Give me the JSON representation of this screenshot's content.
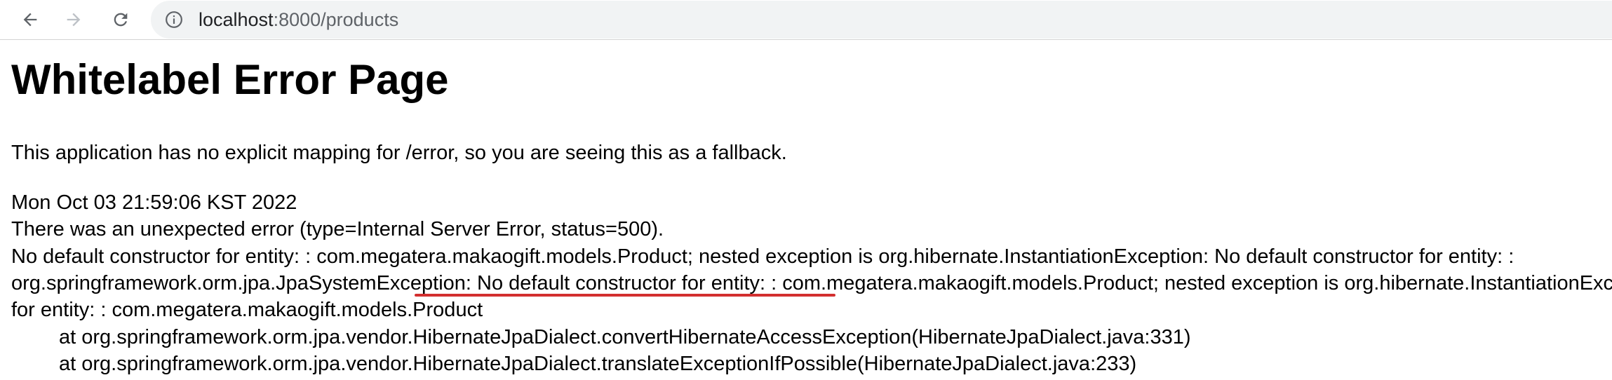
{
  "browser": {
    "url_host": "localhost",
    "url_path": ":8000/products",
    "icons": {
      "back": "arrow-left-icon",
      "forward": "arrow-right-icon",
      "reload": "reload-icon",
      "site_info": "info-circle-icon"
    }
  },
  "page": {
    "title": "Whitelabel Error Page",
    "fallback_message": "This application has no explicit mapping for /error, so you are seeing this as a fallback.",
    "timestamp": "Mon Oct 03 21:59:06 KST 2022",
    "error_type": "There was an unexpected error (type=Internal Server Error, status=500).",
    "detail_lines": [
      "No default constructor for entity: : com.megatera.makaogift.models.Product; nested exception is org.hibernate.InstantiationException: No default constructor for entity: :",
      "org.springframework.orm.jpa.JpaSystemException: No default constructor for entity:  : com.megatera.makaogift.models.Product; nested exception is org.hibernate.InstantiationException: No default constructor",
      "for entity:  : com.megatera.makaogift.models.Product"
    ],
    "stack_trace": [
      "at org.springframework.orm.jpa.vendor.HibernateJpaDialect.convertHibernateAccessException(HibernateJpaDialect.java:331)",
      "at org.springframework.orm.jpa.vendor.HibernateJpaDialect.translateExceptionIfPossible(HibernateJpaDialect.java:233)"
    ]
  },
  "colors": {
    "toolbar_bg": "#ffffff",
    "omnibox_bg": "#f1f3f4",
    "annotation_underline": "#d32f2f"
  }
}
